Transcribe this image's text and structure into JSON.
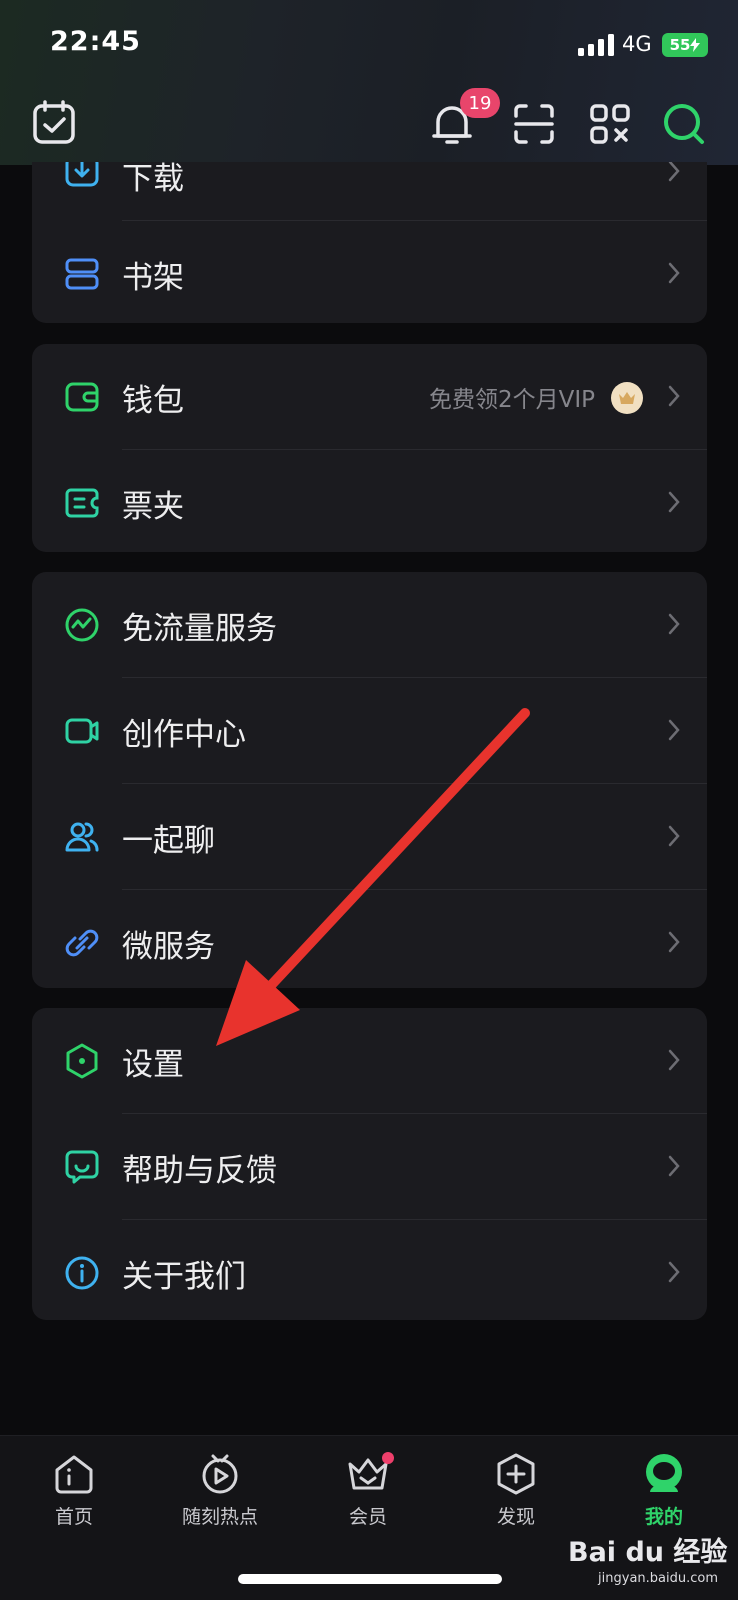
{
  "status": {
    "time": "22:45",
    "network": "4G",
    "battery": "55"
  },
  "toolbar": {
    "notification_count": "19",
    "icons": [
      "calendar-check-icon",
      "bell-icon",
      "scan-icon",
      "qr-code-icon",
      "search-icon"
    ]
  },
  "menu": {
    "card1": [
      {
        "label": "下载",
        "icon": "download-icon"
      },
      {
        "label": "书架",
        "icon": "bookshelf-icon"
      }
    ],
    "card2": [
      {
        "label": "钱包",
        "icon": "wallet-icon",
        "extra": "免费领2个月VIP"
      },
      {
        "label": "票夹",
        "icon": "ticket-icon"
      }
    ],
    "card3": [
      {
        "label": "免流量服务",
        "icon": "data-free-icon"
      },
      {
        "label": "创作中心",
        "icon": "video-camera-icon"
      },
      {
        "label": "一起聊",
        "icon": "users-icon"
      },
      {
        "label": "微服务",
        "icon": "link-icon"
      }
    ],
    "card4": [
      {
        "label": "设置",
        "icon": "settings-icon"
      },
      {
        "label": "帮助与反馈",
        "icon": "feedback-icon"
      },
      {
        "label": "关于我们",
        "icon": "info-icon"
      }
    ]
  },
  "tabbar": {
    "tabs": [
      {
        "label": "首页",
        "icon": "home-icon"
      },
      {
        "label": "随刻热点",
        "icon": "play-clock-icon"
      },
      {
        "label": "会员",
        "icon": "crown-icon"
      },
      {
        "label": "发现",
        "icon": "plus-hexagon-icon"
      },
      {
        "label": "我的",
        "icon": "profile-icon"
      }
    ],
    "active": "我的"
  },
  "watermark": {
    "brand": "Bai du 经验",
    "url": "jingyan.baidu.com"
  },
  "colors": {
    "accent_green": "#2fd36a",
    "badge_red": "#e8456b",
    "background": "#0b0b0d",
    "card": "#1b1b1f",
    "arrow_red": "#e8332d"
  }
}
